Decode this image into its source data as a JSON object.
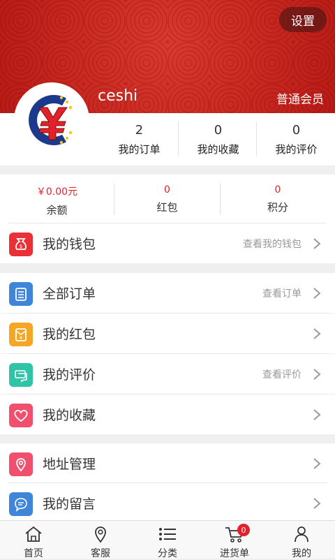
{
  "header": {
    "settings_label": "设置",
    "username": "ceshi",
    "member_level": "普通会员"
  },
  "stats": [
    {
      "value": "2",
      "label": "我的订单"
    },
    {
      "value": "0",
      "label": "我的收藏"
    },
    {
      "value": "0",
      "label": "我的评价"
    }
  ],
  "wallet": {
    "balance": {
      "value": "￥0.00元",
      "label": "余额"
    },
    "redpacket": {
      "value": "0",
      "label": "红包"
    },
    "points": {
      "value": "0",
      "label": "积分"
    },
    "row": {
      "title": "我的钱包",
      "hint": "查看我的钱包"
    }
  },
  "menu_group_1": [
    {
      "title": "全部订单",
      "hint": "查看订单",
      "icon": "order-list-icon",
      "color": "#3f85d8"
    },
    {
      "title": "我的红包",
      "hint": "",
      "icon": "red-packet-icon",
      "color": "#f5a623"
    },
    {
      "title": "我的评价",
      "hint": "查看评价",
      "icon": "comment-icon",
      "color": "#2fc4a8"
    },
    {
      "title": "我的收藏",
      "hint": "",
      "icon": "heart-icon",
      "color": "#f0506e"
    }
  ],
  "menu_group_2": [
    {
      "title": "地址管理",
      "hint": "",
      "icon": "location-icon",
      "color": "#f0506e"
    },
    {
      "title": "我的留言",
      "hint": "",
      "icon": "message-icon",
      "color": "#3f85d8"
    }
  ],
  "bottom_nav": [
    {
      "label": "首页",
      "icon": "home-icon"
    },
    {
      "label": "客服",
      "icon": "location-pin-icon"
    },
    {
      "label": "分类",
      "icon": "list-icon"
    },
    {
      "label": "进货单",
      "icon": "cart-icon",
      "badge": "0"
    },
    {
      "label": "我的",
      "icon": "user-icon"
    }
  ],
  "colors": {
    "header_red": "#c8231f",
    "accent_red": "#e3212a"
  }
}
